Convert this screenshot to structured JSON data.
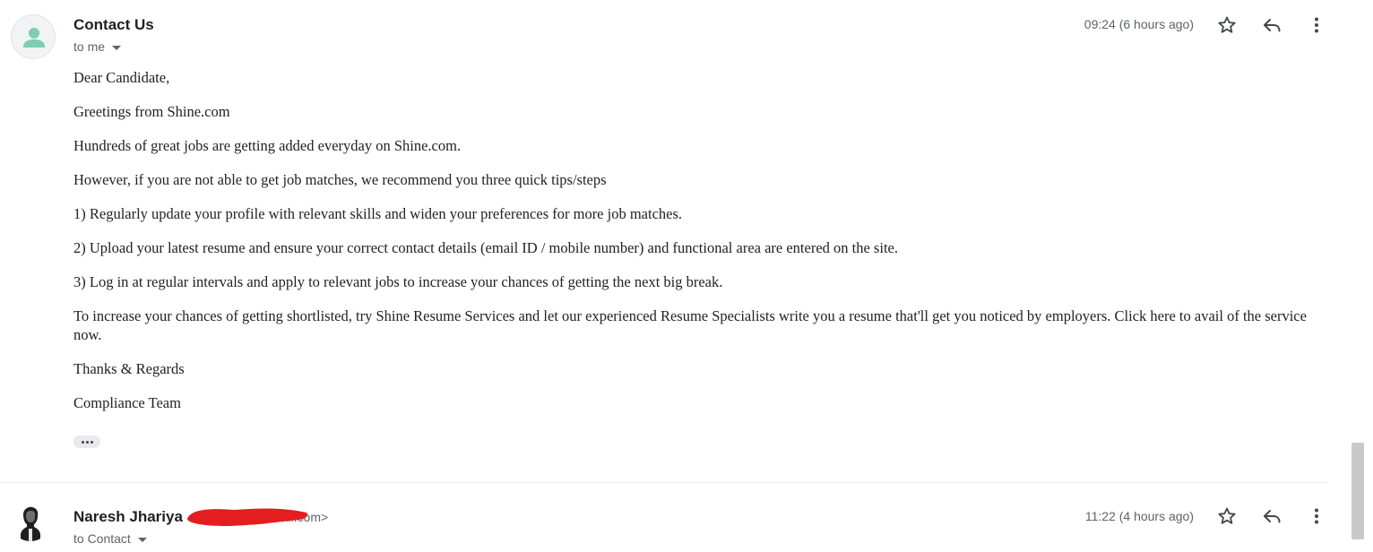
{
  "message1": {
    "sender": "Contact Us",
    "recipient": "to me",
    "time": "09:24 (6 hours ago)",
    "body": [
      "Dear Candidate,",
      "Greetings from Shine.com",
      "Hundreds of great jobs are getting added everyday on Shine.com.",
      "However, if you are not able to get job matches, we recommend you three quick tips/steps",
      "1)  Regularly update your profile with relevant skills and widen your preferences for more job matches.",
      "2)  Upload your latest resume and ensure your correct contact details (email ID / mobile number)  and functional area are entered on the site.",
      "3)  Log in at regular intervals and apply to relevant jobs to increase your chances of getting the next big break.",
      "To increase your chances of getting shortlisted, try Shine Resume Services and let our experienced Resume Specialists write you a resume that'll get you noticed by employers. Click here to avail of the service now.",
      "Thanks & Regards",
      "Compliance Team"
    ],
    "icons": {
      "avatar": "person-icon",
      "star": "star-icon",
      "reply": "reply-icon",
      "more": "more-vert-icon",
      "trimmed": "trimmed-content-icon"
    }
  },
  "message2": {
    "sender": "Naresh Jhariya",
    "email_visible": "mail.com>",
    "recipient": "to Contact",
    "time": "11:22 (4 hours ago)"
  },
  "colors": {
    "avatar_person": "#7ccfb0",
    "redaction": "#e41e1e",
    "secondary_text": "#5f6368"
  }
}
